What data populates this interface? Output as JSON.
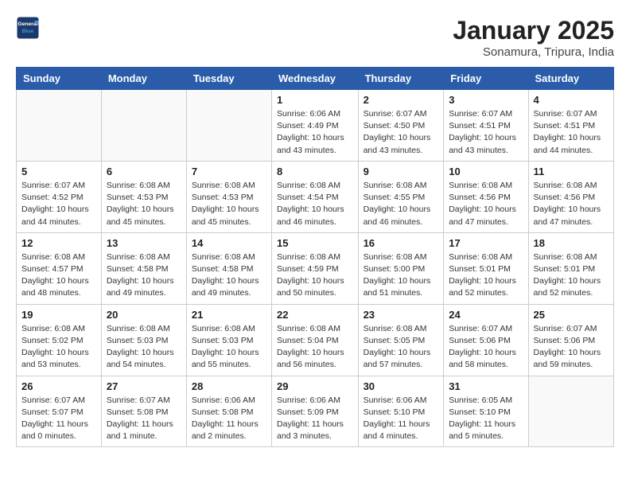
{
  "header": {
    "logo_line1": "General",
    "logo_line2": "Blue",
    "month": "January 2025",
    "location": "Sonamura, Tripura, India"
  },
  "weekdays": [
    "Sunday",
    "Monday",
    "Tuesday",
    "Wednesday",
    "Thursday",
    "Friday",
    "Saturday"
  ],
  "weeks": [
    [
      {
        "day": "",
        "info": ""
      },
      {
        "day": "",
        "info": ""
      },
      {
        "day": "",
        "info": ""
      },
      {
        "day": "1",
        "info": "Sunrise: 6:06 AM\nSunset: 4:49 PM\nDaylight: 10 hours\nand 43 minutes."
      },
      {
        "day": "2",
        "info": "Sunrise: 6:07 AM\nSunset: 4:50 PM\nDaylight: 10 hours\nand 43 minutes."
      },
      {
        "day": "3",
        "info": "Sunrise: 6:07 AM\nSunset: 4:51 PM\nDaylight: 10 hours\nand 43 minutes."
      },
      {
        "day": "4",
        "info": "Sunrise: 6:07 AM\nSunset: 4:51 PM\nDaylight: 10 hours\nand 44 minutes."
      }
    ],
    [
      {
        "day": "5",
        "info": "Sunrise: 6:07 AM\nSunset: 4:52 PM\nDaylight: 10 hours\nand 44 minutes."
      },
      {
        "day": "6",
        "info": "Sunrise: 6:08 AM\nSunset: 4:53 PM\nDaylight: 10 hours\nand 45 minutes."
      },
      {
        "day": "7",
        "info": "Sunrise: 6:08 AM\nSunset: 4:53 PM\nDaylight: 10 hours\nand 45 minutes."
      },
      {
        "day": "8",
        "info": "Sunrise: 6:08 AM\nSunset: 4:54 PM\nDaylight: 10 hours\nand 46 minutes."
      },
      {
        "day": "9",
        "info": "Sunrise: 6:08 AM\nSunset: 4:55 PM\nDaylight: 10 hours\nand 46 minutes."
      },
      {
        "day": "10",
        "info": "Sunrise: 6:08 AM\nSunset: 4:56 PM\nDaylight: 10 hours\nand 47 minutes."
      },
      {
        "day": "11",
        "info": "Sunrise: 6:08 AM\nSunset: 4:56 PM\nDaylight: 10 hours\nand 47 minutes."
      }
    ],
    [
      {
        "day": "12",
        "info": "Sunrise: 6:08 AM\nSunset: 4:57 PM\nDaylight: 10 hours\nand 48 minutes."
      },
      {
        "day": "13",
        "info": "Sunrise: 6:08 AM\nSunset: 4:58 PM\nDaylight: 10 hours\nand 49 minutes."
      },
      {
        "day": "14",
        "info": "Sunrise: 6:08 AM\nSunset: 4:58 PM\nDaylight: 10 hours\nand 49 minutes."
      },
      {
        "day": "15",
        "info": "Sunrise: 6:08 AM\nSunset: 4:59 PM\nDaylight: 10 hours\nand 50 minutes."
      },
      {
        "day": "16",
        "info": "Sunrise: 6:08 AM\nSunset: 5:00 PM\nDaylight: 10 hours\nand 51 minutes."
      },
      {
        "day": "17",
        "info": "Sunrise: 6:08 AM\nSunset: 5:01 PM\nDaylight: 10 hours\nand 52 minutes."
      },
      {
        "day": "18",
        "info": "Sunrise: 6:08 AM\nSunset: 5:01 PM\nDaylight: 10 hours\nand 52 minutes."
      }
    ],
    [
      {
        "day": "19",
        "info": "Sunrise: 6:08 AM\nSunset: 5:02 PM\nDaylight: 10 hours\nand 53 minutes."
      },
      {
        "day": "20",
        "info": "Sunrise: 6:08 AM\nSunset: 5:03 PM\nDaylight: 10 hours\nand 54 minutes."
      },
      {
        "day": "21",
        "info": "Sunrise: 6:08 AM\nSunset: 5:03 PM\nDaylight: 10 hours\nand 55 minutes."
      },
      {
        "day": "22",
        "info": "Sunrise: 6:08 AM\nSunset: 5:04 PM\nDaylight: 10 hours\nand 56 minutes."
      },
      {
        "day": "23",
        "info": "Sunrise: 6:08 AM\nSunset: 5:05 PM\nDaylight: 10 hours\nand 57 minutes."
      },
      {
        "day": "24",
        "info": "Sunrise: 6:07 AM\nSunset: 5:06 PM\nDaylight: 10 hours\nand 58 minutes."
      },
      {
        "day": "25",
        "info": "Sunrise: 6:07 AM\nSunset: 5:06 PM\nDaylight: 10 hours\nand 59 minutes."
      }
    ],
    [
      {
        "day": "26",
        "info": "Sunrise: 6:07 AM\nSunset: 5:07 PM\nDaylight: 11 hours\nand 0 minutes."
      },
      {
        "day": "27",
        "info": "Sunrise: 6:07 AM\nSunset: 5:08 PM\nDaylight: 11 hours\nand 1 minute."
      },
      {
        "day": "28",
        "info": "Sunrise: 6:06 AM\nSunset: 5:08 PM\nDaylight: 11 hours\nand 2 minutes."
      },
      {
        "day": "29",
        "info": "Sunrise: 6:06 AM\nSunset: 5:09 PM\nDaylight: 11 hours\nand 3 minutes."
      },
      {
        "day": "30",
        "info": "Sunrise: 6:06 AM\nSunset: 5:10 PM\nDaylight: 11 hours\nand 4 minutes."
      },
      {
        "day": "31",
        "info": "Sunrise: 6:05 AM\nSunset: 5:10 PM\nDaylight: 11 hours\nand 5 minutes."
      },
      {
        "day": "",
        "info": ""
      }
    ]
  ]
}
